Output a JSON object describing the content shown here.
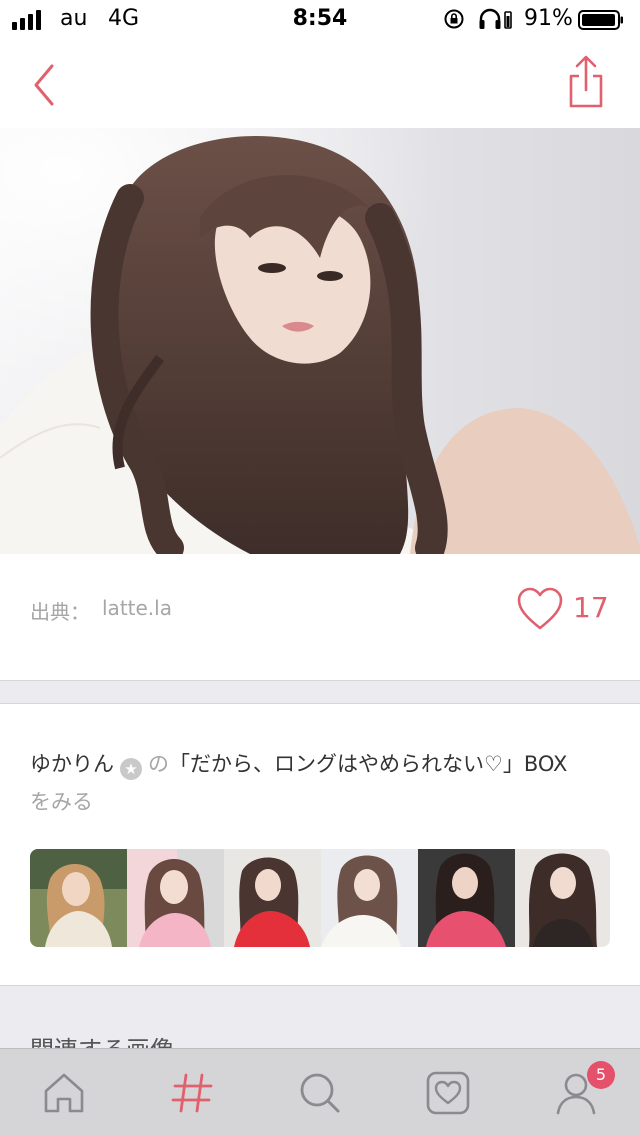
{
  "status_bar": {
    "carrier": "au",
    "network": "4G",
    "time": "8:54",
    "battery_percent": "91%"
  },
  "colors": {
    "accent": "#e0606e",
    "muted": "#a6a6a6",
    "band": "#ebebf0",
    "tab_bg": "#d5d5d8"
  },
  "icons": {
    "back": "chevron-left-icon",
    "share": "share-icon",
    "like": "heart-icon",
    "home": "home-icon",
    "hashtag": "hashtag-icon",
    "search": "search-icon",
    "favorites": "heart-box-icon",
    "profile": "user-icon"
  },
  "source": {
    "label": "出典：",
    "value": "latte.la"
  },
  "like": {
    "count": "17"
  },
  "box": {
    "user": "ゆかりん",
    "no": "の",
    "title": "「だから、ロングはやめられない♡」BOX",
    "see": "をみる"
  },
  "related": {
    "title": "関連する画像"
  },
  "tab_bar": {
    "active": "hashtag",
    "profile_badge": "5"
  }
}
